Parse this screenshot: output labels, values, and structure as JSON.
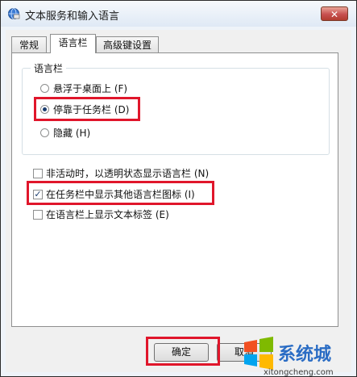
{
  "window": {
    "title": "文本服务和输入语言",
    "close_glyph": "✕",
    "icon": "globe-keyboard-icon"
  },
  "tabs": [
    {
      "label": "常规",
      "active": false
    },
    {
      "label": "语言栏",
      "active": true
    },
    {
      "label": "高级键设置",
      "active": false
    }
  ],
  "language_bar_group": {
    "title": "语言栏",
    "options": [
      {
        "label": "悬浮于桌面上 (F)",
        "checked": false
      },
      {
        "label": "停靠于任务栏 (D)",
        "checked": true
      },
      {
        "label": "隐藏 (H)",
        "checked": false
      }
    ]
  },
  "checkboxes": [
    {
      "label": "非活动时，以透明状态显示语言栏 (N)",
      "checked": false
    },
    {
      "label": "在任务栏中显示其他语言栏图标 (I)",
      "checked": true
    },
    {
      "label": "在语言栏上显示文本标签 (E)",
      "checked": false
    }
  ],
  "buttons": {
    "ok_label": "确定",
    "cancel_label": "取消"
  },
  "watermark": {
    "brand": "系统城",
    "url": "xitongcheng.com"
  },
  "colors": {
    "highlight": "#e0162b",
    "title_bar": "#dfe9f5",
    "close_button": "#c75050"
  }
}
